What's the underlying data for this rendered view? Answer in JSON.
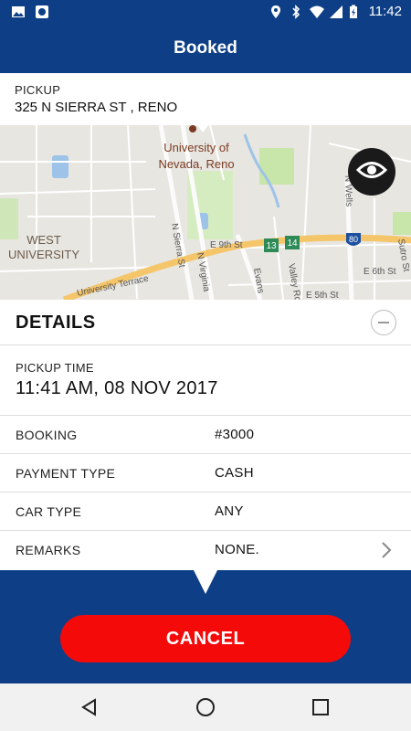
{
  "status_bar": {
    "time": "11:42",
    "left_icons": [
      "image-icon",
      "record-icon"
    ],
    "right_icons": [
      "location-icon",
      "bluetooth-icon",
      "wifi-icon",
      "signal-icon",
      "battery-charging-icon"
    ]
  },
  "header": {
    "title": "Booked"
  },
  "pickup": {
    "label": "PICKUP",
    "address": "325 N SIERRA ST , RENO"
  },
  "map": {
    "labels": {
      "university": "University of",
      "university_2": "Nevada, Reno",
      "west_university": "WEST",
      "west_university_2": "UNIVERSITY",
      "n_sierra_st": "N Sierra St",
      "n_virginia": "N Virginia",
      "e_9th_st": "E 9th St",
      "evans": "Evans",
      "valley_rd": "Valley Rd",
      "university_terrace": "University Terrace",
      "e_6th_st": "E 6th St",
      "e_5th_st": "E 5th St",
      "sutro_st": "Sutro St",
      "n_wells": "N Wells",
      "shield_13": "13",
      "shield_14": "14",
      "shield_80": "80"
    },
    "colors": {
      "highway": "#f5c56a",
      "park": "#c8e6a9",
      "water": "#9ec3e8"
    }
  },
  "details": {
    "title": "DETAILS",
    "pickup_time_label": "PICKUP TIME",
    "pickup_time_value": "11:41 AM, 08 NOV 2017",
    "rows": [
      {
        "label": "BOOKING",
        "value": "#3000"
      },
      {
        "label": "PAYMENT TYPE",
        "value": "CASH"
      },
      {
        "label": "CAR TYPE",
        "value": "ANY"
      },
      {
        "label": "REMARKS",
        "value": "NONE."
      }
    ]
  },
  "actions": {
    "cancel_label": "CANCEL"
  },
  "colors": {
    "primary": "#0e3f86",
    "cancel": "#f50a0a"
  },
  "nav_bar": {
    "icons": [
      "back-icon",
      "home-icon",
      "recents-icon"
    ]
  }
}
